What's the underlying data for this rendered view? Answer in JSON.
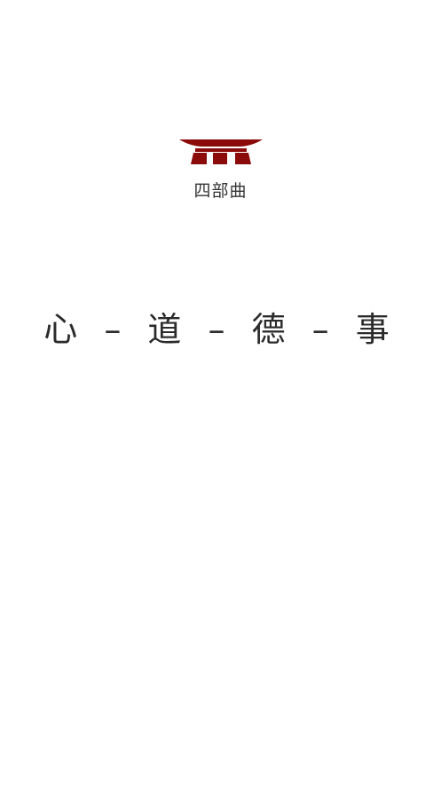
{
  "brand": {
    "logo_icon": "torii-gate-icon",
    "logo_color": "#8b0a0a",
    "name": "四部曲"
  },
  "splash": {
    "slogan": "心 – 道 – 德 – 事"
  }
}
